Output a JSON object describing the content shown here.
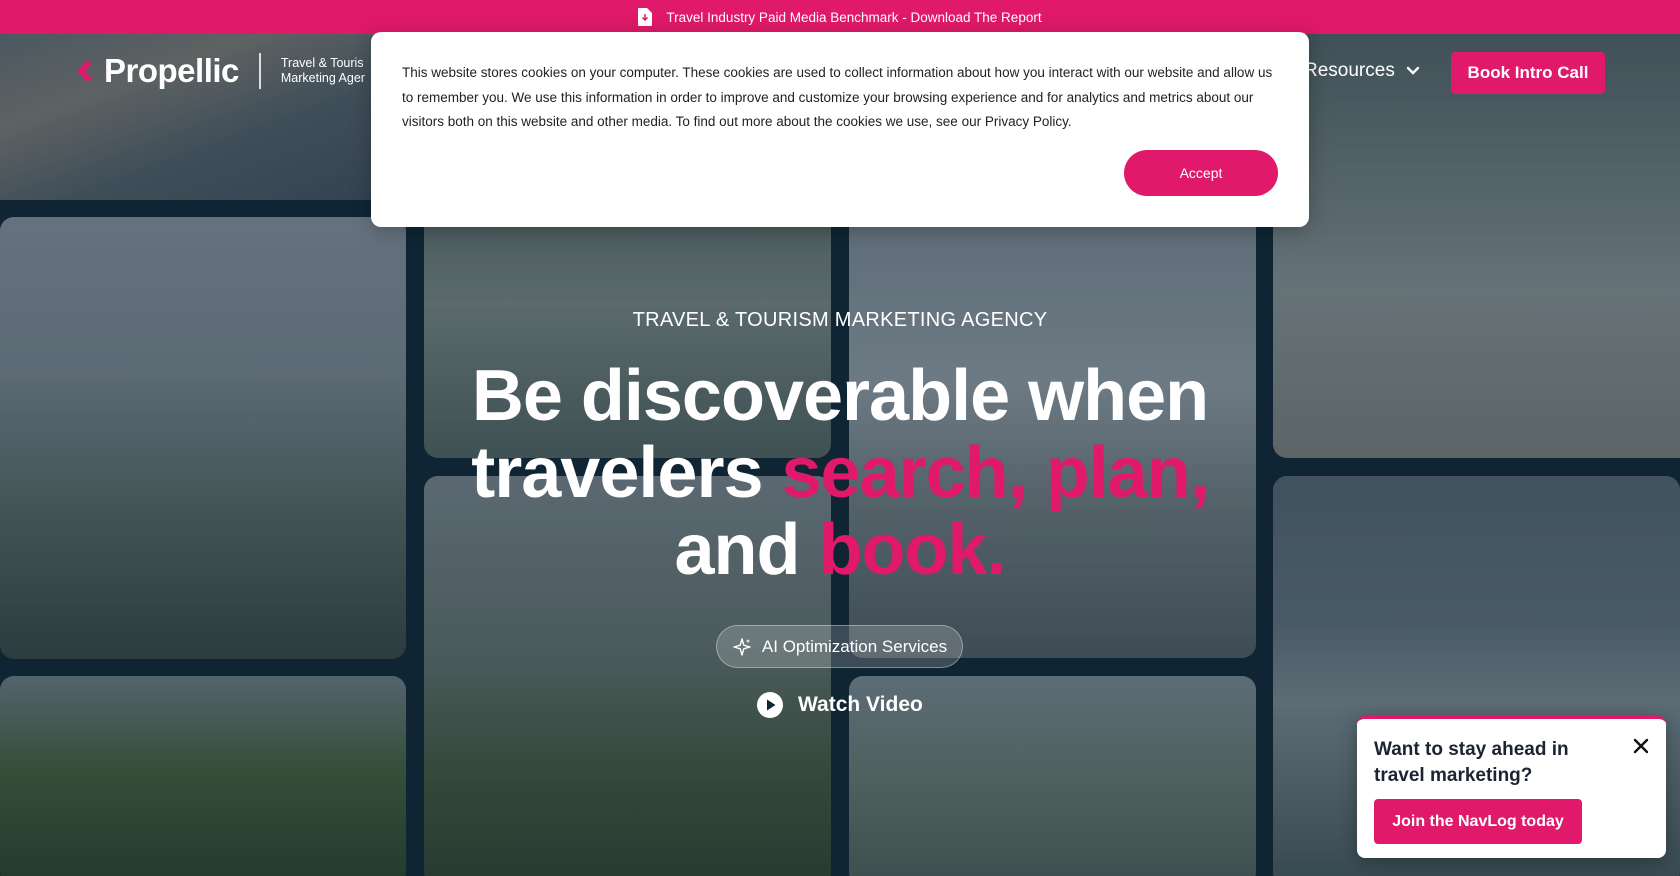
{
  "announcement": {
    "icon": "document-download-icon",
    "text": "Travel Industry Paid Media Benchmark - Download The Report"
  },
  "header": {
    "logo_text": "Propellic",
    "tagline_line1": "Travel & Touris",
    "tagline_line2": "Marketing Ager",
    "nav_resources": "Resources",
    "cta_label": "Book Intro Call"
  },
  "hero": {
    "eyebrow": "TRAVEL & TOURISM MARKETING AGENCY",
    "headline_part1": "Be discoverable when travelers ",
    "headline_highlight1": "search, plan,",
    "headline_part2": "and ",
    "headline_highlight2": "book.",
    "pill_label": "AI Optimization Services",
    "watch_label": "Watch Video"
  },
  "cookie_banner": {
    "text": "This website stores cookies on your computer. These cookies are used to collect information about how you interact with our website and allow us to remember you. We use this information in order to improve and customize your browsing experience and for analytics and metrics about our visitors both on this website and other media. To find out more about the cookies we use, see our Privacy Policy.",
    "accept_label": "Accept"
  },
  "navlog_popup": {
    "title": "Want to stay ahead in travel marketing?",
    "button_label": "Join the NavLog today"
  },
  "colors": {
    "brand_pink": "#e0196a",
    "overlay_navy": "#102534"
  }
}
